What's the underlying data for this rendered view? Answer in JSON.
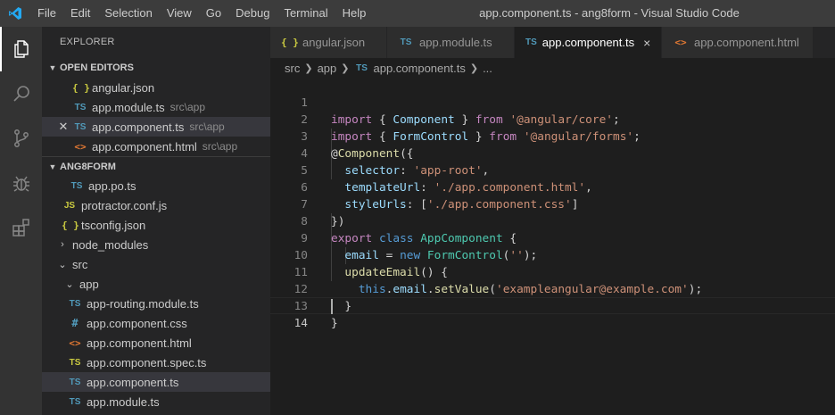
{
  "window": {
    "title": "app.component.ts - ang8form - Visual Studio Code"
  },
  "menu": [
    "File",
    "Edit",
    "Selection",
    "View",
    "Go",
    "Debug",
    "Terminal",
    "Help"
  ],
  "activity_bar": [
    "explorer-icon",
    "search-icon",
    "source-control-icon",
    "debug-icon",
    "extensions-icon"
  ],
  "sidebar": {
    "title": "EXPLORER",
    "open_editors_header": "OPEN EDITORS",
    "open_editors": [
      {
        "icon": "{ }",
        "name": "angular.json",
        "desc": ""
      },
      {
        "icon": "TS",
        "name": "app.module.ts",
        "desc": "src\\app"
      },
      {
        "icon": "TS",
        "name": "app.component.ts",
        "desc": "src\\app"
      },
      {
        "icon": "<>",
        "name": "app.component.html",
        "desc": "src\\app"
      }
    ],
    "project_header": "ANG8FORM",
    "tree": [
      {
        "icon": "TS",
        "name": "app.po.ts"
      },
      {
        "icon": "JS",
        "name": "protractor.conf.js"
      },
      {
        "icon": "{ }",
        "name": "tsconfig.json"
      },
      {
        "name": "node_modules"
      },
      {
        "name": "src"
      },
      {
        "name": "app"
      },
      {
        "icon": "TS",
        "name": "app-routing.module.ts"
      },
      {
        "icon": "#",
        "name": "app.component.css"
      },
      {
        "icon": "<>",
        "name": "app.component.html"
      },
      {
        "icon": "TS",
        "name": "app.component.spec.ts"
      },
      {
        "icon": "TS",
        "name": "app.component.ts"
      },
      {
        "icon": "TS",
        "name": "app.module.ts"
      }
    ]
  },
  "tabs": [
    {
      "icon": "{ }",
      "label": "angular.json"
    },
    {
      "icon": "TS",
      "label": "app.module.ts"
    },
    {
      "icon": "TS",
      "label": "app.component.ts",
      "close": "×"
    },
    {
      "icon": "<>",
      "label": "app.component.html"
    }
  ],
  "breadcrumb": {
    "part1": "src",
    "part2": "app",
    "icon": "TS",
    "part3": "app.component.ts",
    "part4": "..."
  },
  "editor": {
    "line_numbers": [
      "1",
      "2",
      "3",
      "4",
      "5",
      "6",
      "7",
      "8",
      "9",
      "10",
      "11",
      "12",
      "13",
      "14"
    ],
    "tokens": {
      "import": "import",
      "open_brace": "{",
      "close_brace": "}",
      "Component": "Component",
      "FormControl": "FormControl",
      "from": "from",
      "core_path": "'@angular/core'",
      "forms_path": "'@angular/forms'",
      "semi": ";",
      "decorator_at": "@",
      "decorator_open": "({",
      "selector": "selector",
      "selector_val": "'app-root'",
      "templateUrl": "templateUrl",
      "template_val": "'./app.component.html'",
      "styleUrls": "styleUrls",
      "style_val": "'./app.component.css'",
      "decorator_close": "})",
      "export": "export",
      "class": "class",
      "AppComponent": "AppComponent",
      "email": "email",
      "new": "new",
      "empty_str": "''",
      "updateEmail": "updateEmail",
      "this": "this",
      "setValue": "setValue",
      "email_val": "'exampleangular@example.com'"
    }
  }
}
